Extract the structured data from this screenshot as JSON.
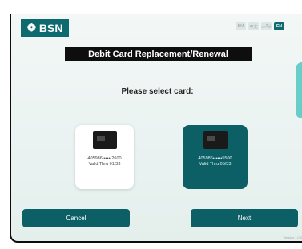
{
  "brand": {
    "symbol": "❁",
    "name": "BSN"
  },
  "languages": [
    {
      "code": "BM",
      "active": false
    },
    {
      "code": "中文",
      "active": false
    },
    {
      "code": "தமிழ்",
      "active": false
    },
    {
      "code": "EN",
      "active": true
    }
  ],
  "title": "Debit Card Replacement/Renewal",
  "prompt": "Please select card:",
  "cards": [
    {
      "number": "405986••••••2600",
      "valid": "Valid Thru 01/33",
      "selected": false
    },
    {
      "number": "405986••••••5500",
      "valid": "Valid Thru 05/33",
      "selected": true
    }
  ],
  "buttons": {
    "cancel": "Cancel",
    "next": "Next"
  },
  "version": "Version 1.0.0",
  "colors": {
    "brand": "#0d6b70",
    "button": "#0d5f66",
    "accent": "#4fc7bf"
  }
}
